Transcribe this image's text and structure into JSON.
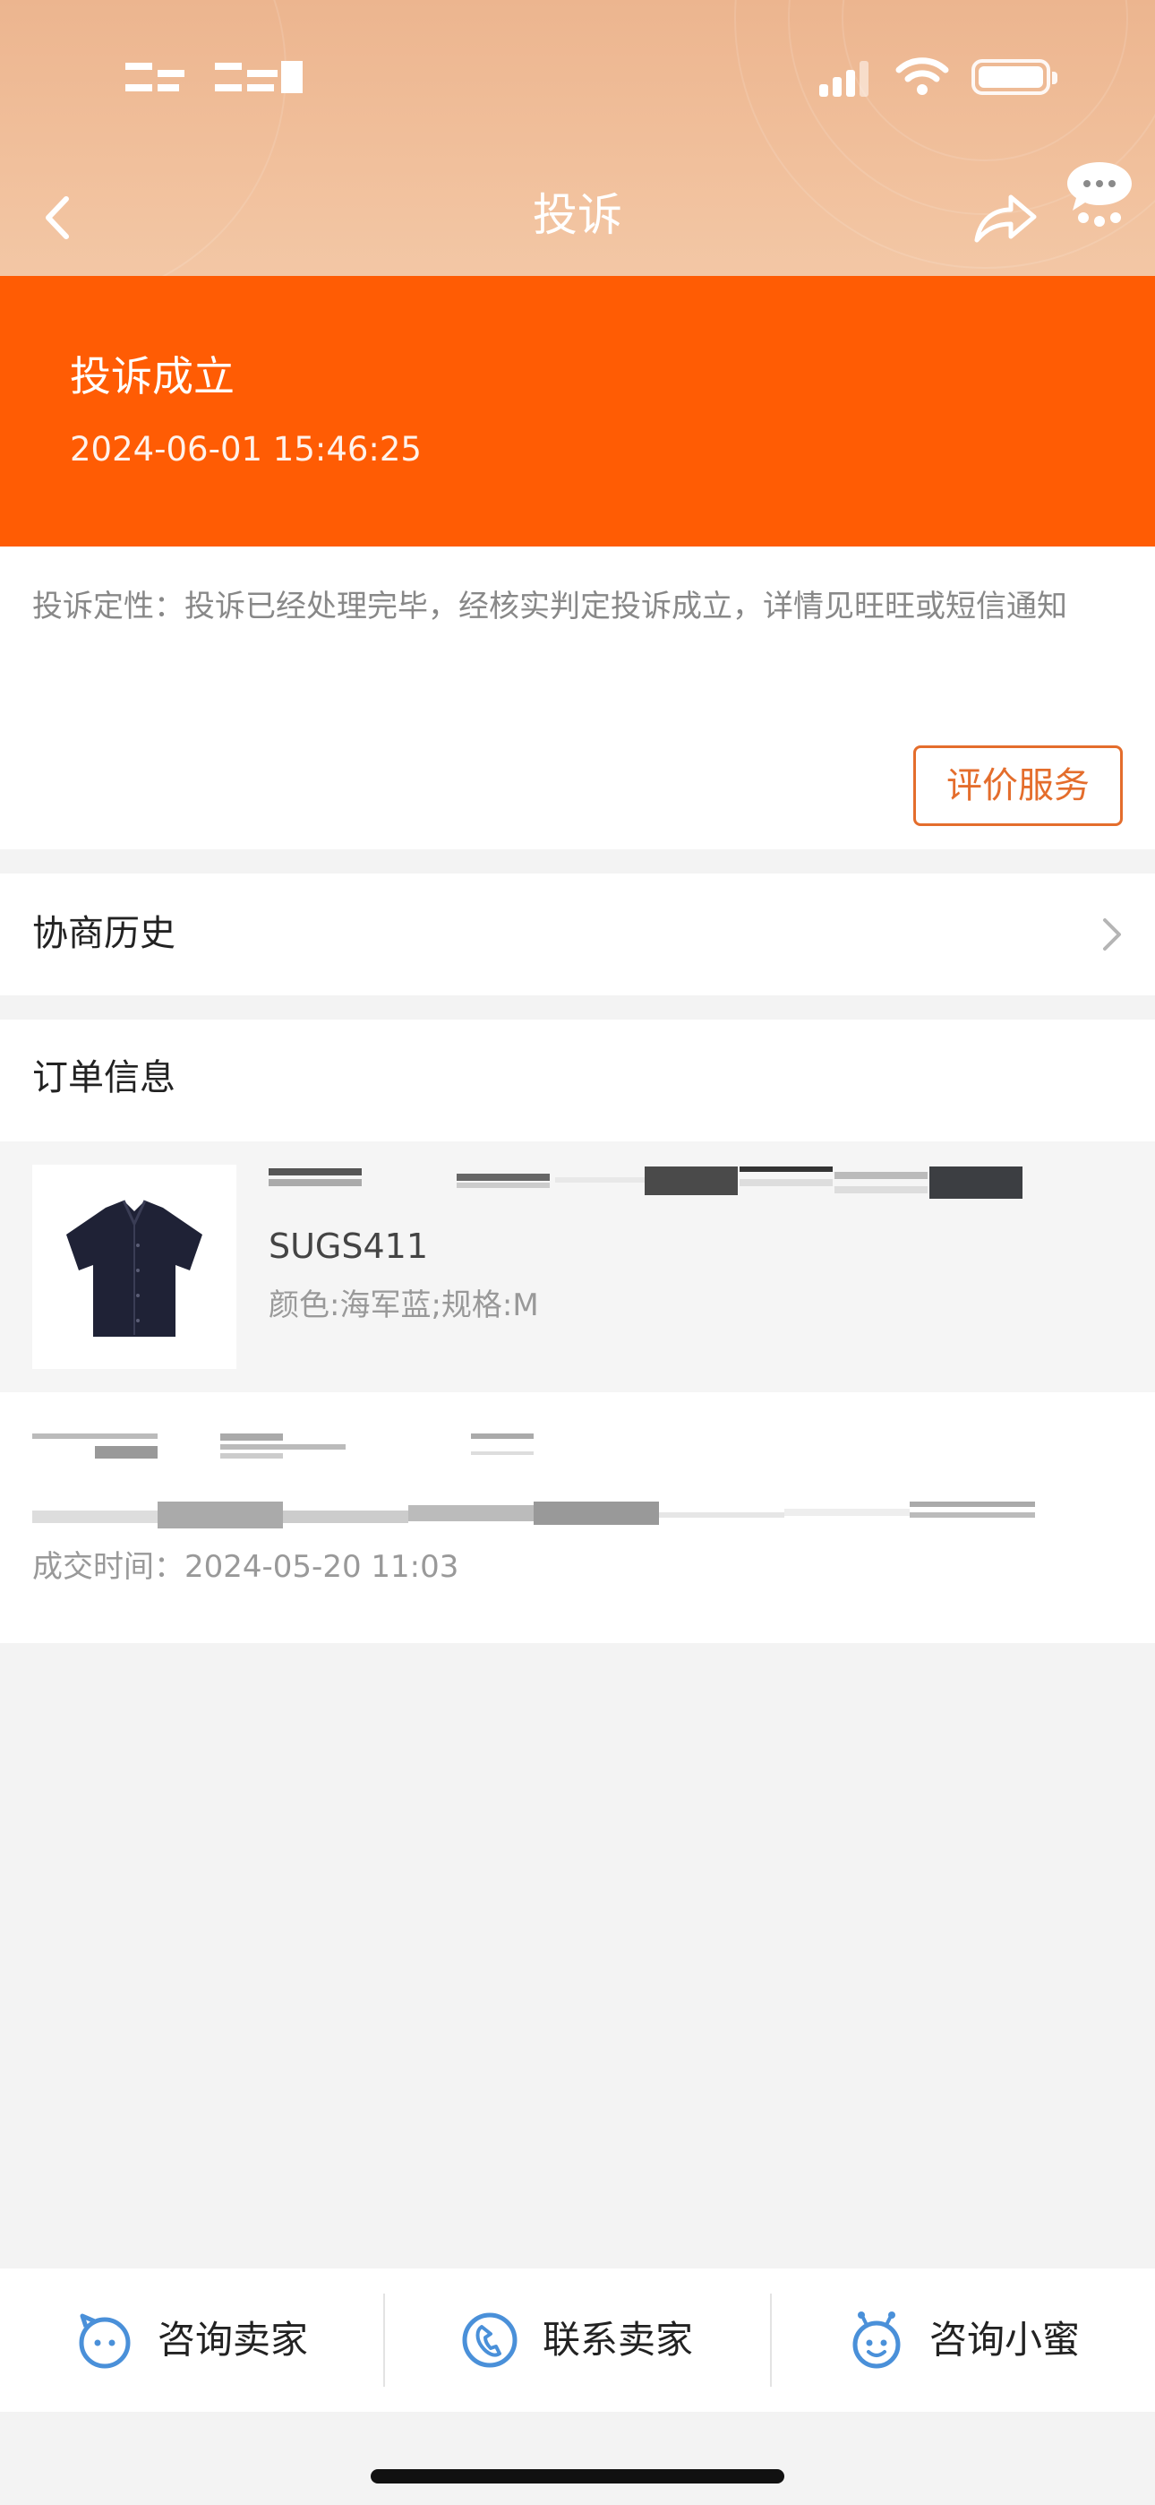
{
  "nav": {
    "title": "投诉",
    "icons": {
      "back": "chevron-left-icon",
      "share": "share-icon",
      "more": "more-dots-icon"
    }
  },
  "status_bar": {
    "icons": [
      "signal-icon",
      "wifi-icon",
      "battery-icon"
    ]
  },
  "banner": {
    "title": "投诉成立",
    "time": "2024-06-01 15:46:25",
    "color": "#ff5c04"
  },
  "result": {
    "text": "投诉定性：投诉已经处理完毕，经核实判定投诉成立，详情见旺旺或短信通知",
    "rate_button": "评价服务"
  },
  "history": {
    "label": "协商历史"
  },
  "order": {
    "heading": "订单信息",
    "product": {
      "code": "SUGS411",
      "spec": "颜色:海军蓝;规格:M"
    },
    "deal_time": "成交时间：2024-05-20 11:03"
  },
  "bottom_bar": {
    "items": [
      {
        "label": "咨询卖家",
        "icon": "chat-face-icon"
      },
      {
        "label": "联系卖家",
        "icon": "phone-icon"
      },
      {
        "label": "咨询小蜜",
        "icon": "assistant-bee-icon"
      }
    ]
  },
  "colors": {
    "accent": "#ff5c04",
    "button_border": "#e46d2c",
    "icon_blue": "#4a90d9"
  }
}
